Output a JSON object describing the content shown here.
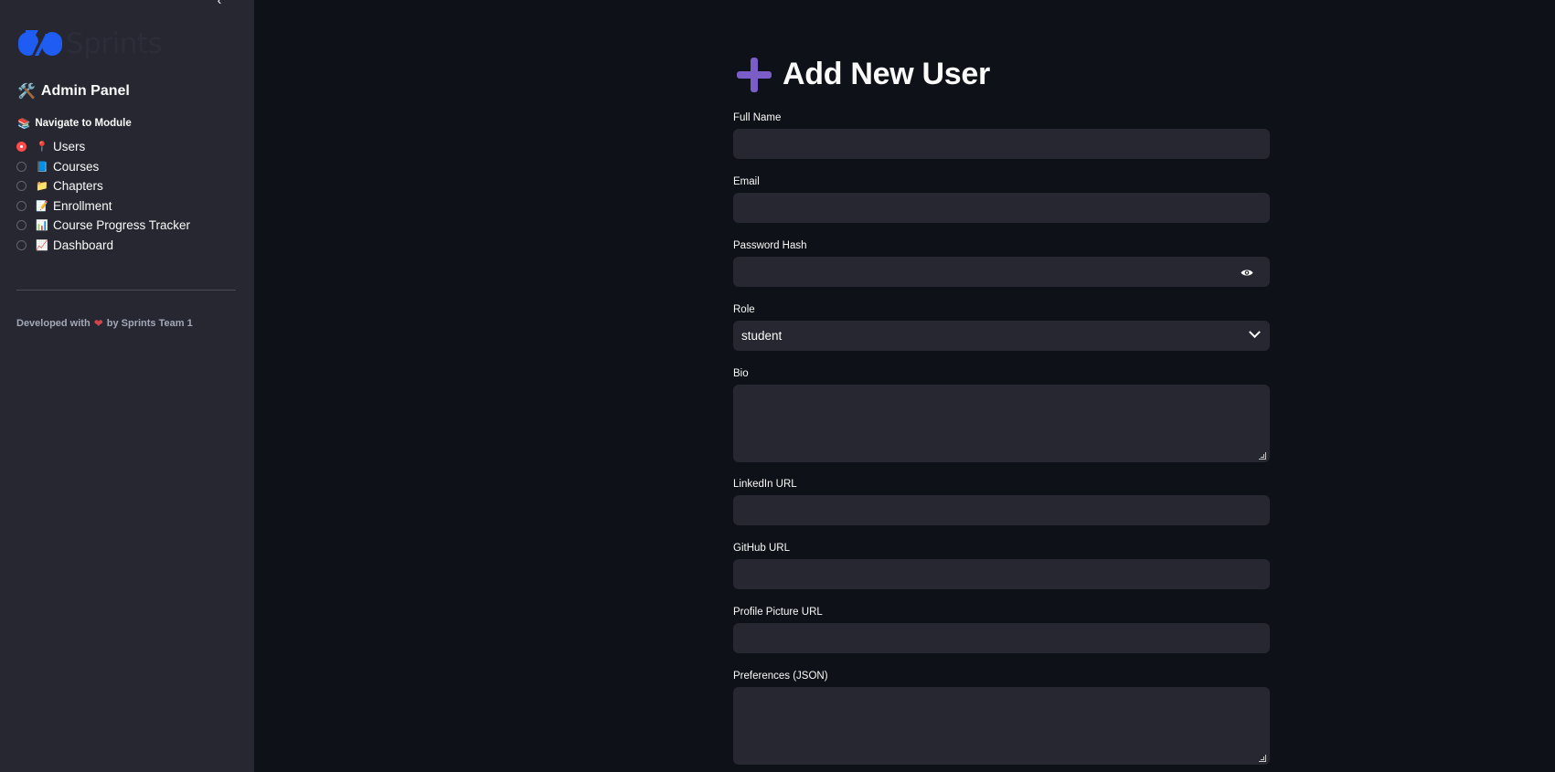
{
  "sidebar": {
    "logo_text": "Sprints",
    "title": "Admin Panel",
    "title_icon": "hammer-wrench-icon",
    "nav_label": "Navigate to Module",
    "nav_icon": "books-icon",
    "items": [
      {
        "label": "Users",
        "icon": "pin-icon",
        "glyph": "📍",
        "checked": true
      },
      {
        "label": "Courses",
        "icon": "book-icon",
        "glyph": "📘",
        "checked": false
      },
      {
        "label": "Chapters",
        "icon": "folder-icon",
        "glyph": "📁",
        "checked": false
      },
      {
        "label": "Enrollment",
        "icon": "memo-icon",
        "glyph": "📝",
        "checked": false
      },
      {
        "label": "Course Progress Tracker",
        "icon": "bar-chart-icon",
        "glyph": "📊",
        "checked": false
      },
      {
        "label": "Dashboard",
        "icon": "trend-chart-icon",
        "glyph": "📈",
        "checked": false
      }
    ],
    "footer_prefix": "Developed with",
    "footer_suffix": "by Sprints Team 1"
  },
  "main": {
    "title": "Add New User",
    "fields": {
      "full_name": {
        "label": "Full Name",
        "value": ""
      },
      "email": {
        "label": "Email",
        "value": ""
      },
      "password": {
        "label": "Password Hash",
        "value": ""
      },
      "role": {
        "label": "Role",
        "value": "student"
      },
      "bio": {
        "label": "Bio",
        "value": ""
      },
      "linkedin": {
        "label": "LinkedIn URL",
        "value": ""
      },
      "github": {
        "label": "GitHub URL",
        "value": ""
      },
      "picture": {
        "label": "Profile Picture URL",
        "value": ""
      },
      "preferences": {
        "label": "Preferences (JSON)",
        "value": ""
      }
    }
  },
  "colors": {
    "background": "#0e1117",
    "sidebar": "#262730",
    "input": "#262730",
    "accent_radio": "#ff4b4b",
    "plus_icon": "#7b5dc7",
    "logo_blue": "#1f5cf2"
  }
}
